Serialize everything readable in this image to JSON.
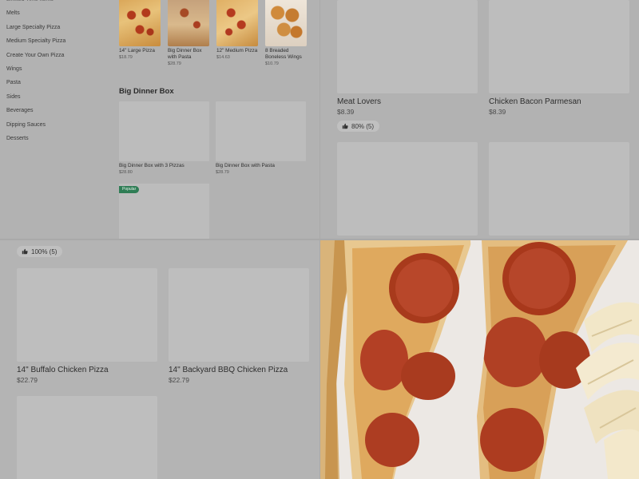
{
  "sidebar": {
    "items": [
      {
        "label": "Limited Time Items"
      },
      {
        "label": "Melts"
      },
      {
        "label": "Large Specialty Pizza"
      },
      {
        "label": "Medium Specialty Pizza"
      },
      {
        "label": "Create Your Own Pizza"
      },
      {
        "label": "Wings"
      },
      {
        "label": "Pasta"
      },
      {
        "label": "Sides"
      },
      {
        "label": "Beverages"
      },
      {
        "label": "Dipping Sauces"
      },
      {
        "label": "Desserts"
      }
    ]
  },
  "featured": {
    "items": [
      {
        "name": "14\" Large Pizza",
        "price": "$18.79"
      },
      {
        "name": "Big Dinner Box with Pasta",
        "price": "$28.79"
      },
      {
        "name": "12\" Medium Pizza",
        "price": "$14.63"
      },
      {
        "name": "8 Breaded Boneless Wings",
        "price": "$10.79"
      }
    ]
  },
  "big_dinner_box": {
    "title": "Big Dinner Box",
    "items": [
      {
        "name": "Big Dinner Box with 3 Pizzas",
        "price": "$28.80"
      },
      {
        "name": "Big Dinner Box with Pasta",
        "price": "$28.79"
      }
    ],
    "popular_badge": "Popular"
  },
  "zoom_top": {
    "items": [
      {
        "name": "Meat Lovers",
        "price": "$8.39",
        "rating": "80% (5)"
      },
      {
        "name": "Chicken Bacon Parmesan",
        "price": "$8.39"
      }
    ]
  },
  "zoom_bottom": {
    "rating": "100% (5)",
    "items": [
      {
        "name": "14\" Buffalo Chicken Pizza",
        "price": "$22.79"
      },
      {
        "name": "14\" Backyard BBQ Chicken Pizza",
        "price": "$22.79"
      }
    ]
  },
  "colors": {
    "overlay": "#b2b2b2",
    "popular_badge": "#2f7d55",
    "placeholder": "#bdbdbd"
  },
  "icons": [
    "thumbs-up-icon"
  ]
}
